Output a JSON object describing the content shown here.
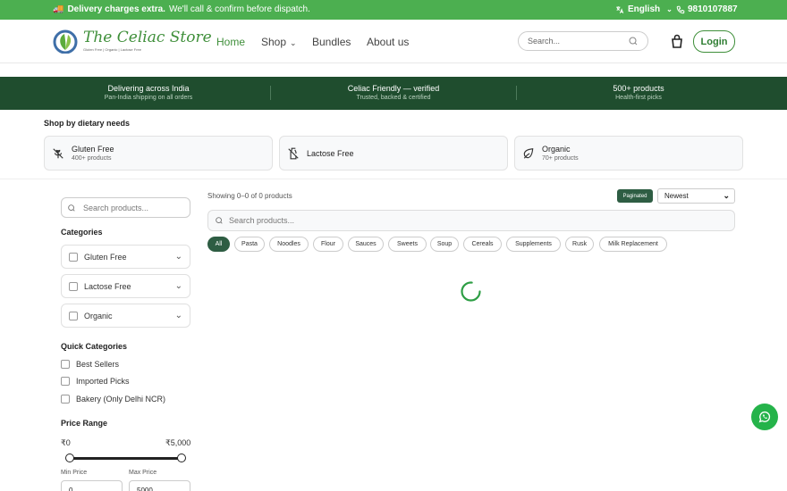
{
  "topbar": {
    "promo_bold": "Delivery charges extra.",
    "promo_rest": "We'll call & confirm before dispatch.",
    "language": "English",
    "phone": "9810107887"
  },
  "header": {
    "brand": "The Celiac Store",
    "tagline": "Gluten Free | Organic | Lactose Free",
    "nav": [
      "Home",
      "Shop",
      "Bundles",
      "About us"
    ],
    "search_placeholder": "Search...",
    "login": "Login"
  },
  "band": [
    {
      "title": "Delivering across India",
      "sub": "Pan-India shipping on all orders"
    },
    {
      "title": "Celiac Friendly — verified",
      "sub": "Trusted, backed & certified"
    },
    {
      "title": "500+ products",
      "sub": "Health-first picks"
    }
  ],
  "dietary": {
    "title": "Shop by dietary needs",
    "items": [
      {
        "name": "Gluten Free",
        "count": "400+ products",
        "icon": "wheat-off-icon"
      },
      {
        "name": "Lactose Free",
        "count": "",
        "icon": "milk-off-icon"
      },
      {
        "name": "Organic",
        "count": "70+ products",
        "icon": "leaf-icon"
      }
    ]
  },
  "sidebar": {
    "search_placeholder": "Search products...",
    "categories_title": "Categories",
    "categories": [
      "Gluten Free",
      "Lactose Free",
      "Organic"
    ],
    "quick_title": "Quick Categories",
    "quick": [
      "Best Sellers",
      "Imported Picks",
      "Bakery (Only Delhi NCR)"
    ],
    "price_title": "Price Range",
    "price_min_label": "₹0",
    "price_max_label": "₹5,000",
    "min_price_label": "Min Price",
    "max_price_label": "Max Price",
    "min_price_value": "0",
    "max_price_value": "5000"
  },
  "main": {
    "showing": "Showing 0–0 of 0 products",
    "paginated": "Paginated",
    "sort": "Newest",
    "search_placeholder": "Search products...",
    "chips": [
      "All",
      "Pasta",
      "Noodles",
      "Flour",
      "Sauces",
      "Sweets",
      "Soup",
      "Cereals",
      "Supplements",
      "Rusk",
      "Milk Replacement"
    ]
  },
  "colors": {
    "brand_green": "#4caf50",
    "dark_green": "#1f4d2e",
    "accent": "#2e5d43",
    "whatsapp": "#25b34a"
  }
}
